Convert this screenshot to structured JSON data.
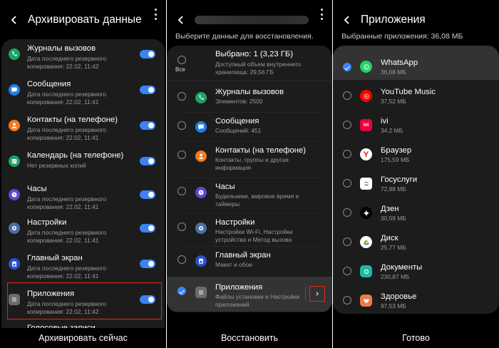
{
  "backup": {
    "title": "Архивировать данные",
    "items": [
      {
        "name": "Журналы вызовов",
        "desc": "Дата последнего резервного копирования: 22.02, 11:42",
        "icon": "phone-icon",
        "color": "#1fa463"
      },
      {
        "name": "Сообщения",
        "desc": "Дата последнего резервного копирования: 22.02, 11:41",
        "icon": "message-icon",
        "color": "#1f80e8"
      },
      {
        "name": "Контакты (на телефоне)",
        "desc": "Дата последнего резервного копирования: 22.02, 11:41",
        "icon": "contact-icon",
        "color": "#f47a1f"
      },
      {
        "name": "Календарь (на телефоне)",
        "desc": "Нет резервных копий",
        "icon": "calendar-icon",
        "color": "#1fa463"
      },
      {
        "name": "Часы",
        "desc": "Дата последнего резервного копирования: 22.02, 11:41",
        "icon": "clock-icon",
        "color": "#5a4ad1"
      },
      {
        "name": "Настройки",
        "desc": "Дата последнего резервного копирования: 22.02, 11:41",
        "icon": "gear-icon",
        "color": "#4a6fa5"
      },
      {
        "name": "Главный экран",
        "desc": "Дата последнего резервного копирования: 22.02, 11:41",
        "icon": "home-icon",
        "color": "#2a4fd1"
      },
      {
        "name": "Приложения",
        "desc": "Дата последнего резервного копирования: 22.02, 11:42",
        "icon": "apps-grid-icon",
        "color": "#6b6b6b"
      }
    ],
    "partial_item": "Голосовые записи",
    "action": "Архивировать сейчас"
  },
  "restore": {
    "subtitle": "Выберите данные для восстановления.",
    "select_all_label": "Все",
    "summary_title": "Выбрано: 1 (3,23 ГБ)",
    "summary_desc": "Доступный объем внутреннего хранилища: 29,56 ГБ",
    "items": [
      {
        "name": "Журналы вызовов",
        "desc": "Элементов: 2500",
        "icon": "phone-icon",
        "color": "#1fa463"
      },
      {
        "name": "Сообщения",
        "desc": "Сообщений: 451",
        "icon": "message-icon",
        "color": "#1f80e8"
      },
      {
        "name": "Контакты (на телефоне)",
        "desc": "Контакты, группы и другая информация",
        "icon": "contact-icon",
        "color": "#f47a1f"
      },
      {
        "name": "Часы",
        "desc": "Будильники, мировое время и таймеры",
        "icon": "clock-icon",
        "color": "#5a4ad1"
      },
      {
        "name": "Настройки",
        "desc": "Настройки Wi-Fi, Настройки устройства и Метод вызова",
        "icon": "gear-icon",
        "color": "#4a6fa5"
      },
      {
        "name": "Главный экран",
        "desc": "Макет и обои",
        "icon": "home-icon",
        "color": "#2a4fd1"
      },
      {
        "name": "Приложения",
        "desc": "Файлы установки и Настройки приложений",
        "icon": "apps-grid-icon",
        "color": "#6b6b6b"
      }
    ],
    "action": "Восстановить"
  },
  "apps": {
    "title": "Приложения",
    "subtitle": "Выбранные приложения: 36,08 МБ",
    "items": [
      {
        "name": "WhatsApp",
        "size": "36,08 МБ",
        "icon": "whatsapp-icon",
        "color": "#25d366",
        "checked": true
      },
      {
        "name": "YouTube Music",
        "size": "37,52 МБ",
        "icon": "youtube-music-icon",
        "color": "#ff0000"
      },
      {
        "name": "ivi",
        "size": "34,2 МБ",
        "icon": "ivi-icon",
        "color": "#ea003d"
      },
      {
        "name": "Браузер",
        "size": "175,59 МБ",
        "icon": "yandex-browser-icon",
        "color": "#ffffff"
      },
      {
        "name": "Госуслуги",
        "size": "72,88 МБ",
        "icon": "gosuslugi-icon",
        "color": "#ffffff"
      },
      {
        "name": "Дзен",
        "size": "30,59 МБ",
        "icon": "dzen-icon",
        "color": "#000000"
      },
      {
        "name": "Диск",
        "size": "25,77 МБ",
        "icon": "google-drive-icon",
        "color": "#ffffff"
      },
      {
        "name": "Документы",
        "size": "230,87 МБ",
        "icon": "documents-icon",
        "color": "#1fb8a0"
      },
      {
        "name": "Здоровье",
        "size": "97,53 МБ",
        "icon": "health-icon",
        "color": "#f07a4a"
      }
    ],
    "action": "Готово"
  }
}
